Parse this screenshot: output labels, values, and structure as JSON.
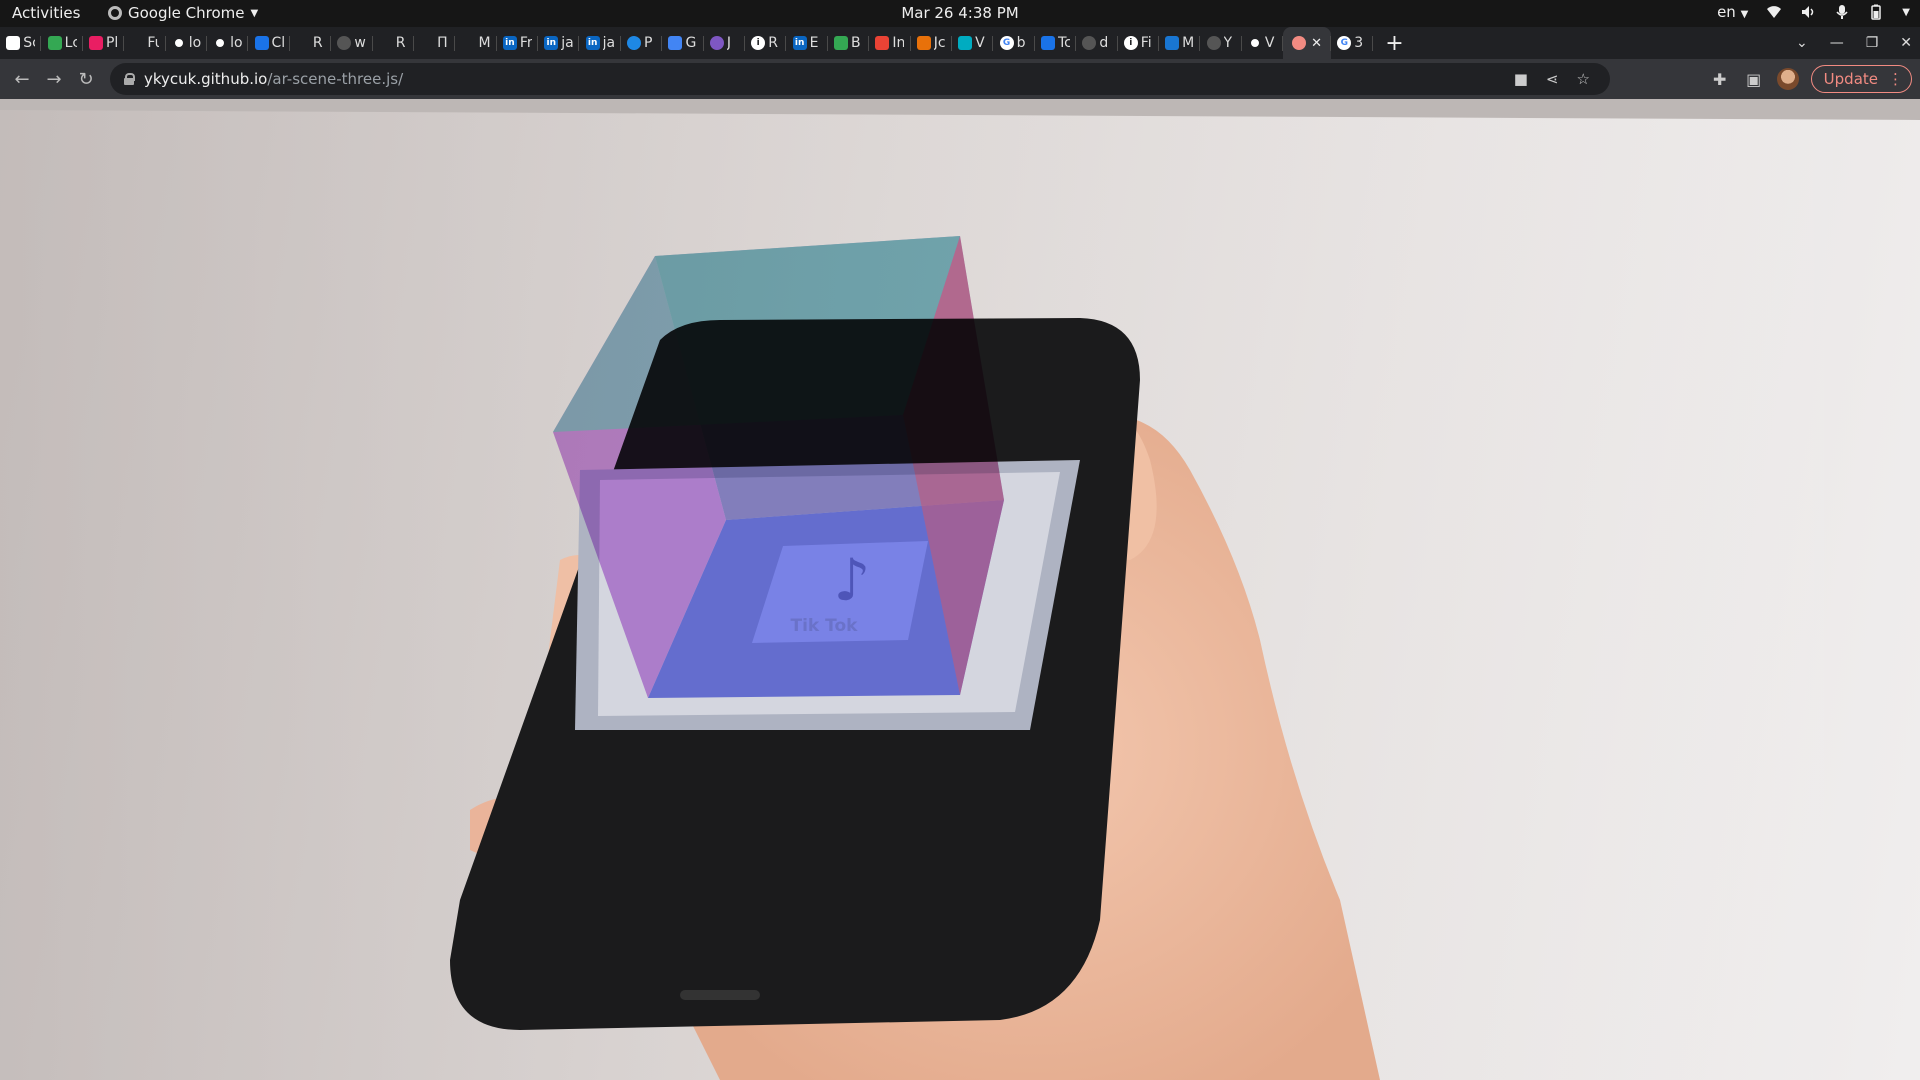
{
  "topbar": {
    "activities": "Activities",
    "app_name": "Google Chrome",
    "clock": "Mar 26  4:38 PM",
    "lang": "en"
  },
  "tabs": [
    {
      "text": "Sc",
      "icon": "generic",
      "color": "#ffffff"
    },
    {
      "text": "Lc",
      "icon": "leaf",
      "color": "#34a853"
    },
    {
      "text": "Pl",
      "icon": "app",
      "color": "#e91e63"
    },
    {
      "text": "Fu",
      "icon": "generic",
      "color": "#202124"
    },
    {
      "text": "lo",
      "icon": "github",
      "color": "#ffffff"
    },
    {
      "text": "lo",
      "icon": "github",
      "color": "#ffffff"
    },
    {
      "text": "Cl",
      "icon": "chart",
      "color": "#1a73e8"
    },
    {
      "text": "R",
      "icon": "generic",
      "color": "#202124"
    },
    {
      "text": "w",
      "icon": "github",
      "color": "#555555"
    },
    {
      "text": "R",
      "icon": "generic",
      "color": "#202124"
    },
    {
      "text": "П",
      "icon": "generic",
      "color": "#202124"
    },
    {
      "text": "M",
      "icon": "generic",
      "color": "#202124"
    },
    {
      "text": "Fr",
      "icon": "linkedin",
      "color": "#0a66c2"
    },
    {
      "text": "ja",
      "icon": "linkedin",
      "color": "#0a66c2"
    },
    {
      "text": "ja",
      "icon": "linkedin",
      "color": "#0a66c2"
    },
    {
      "text": "P",
      "icon": "circle",
      "color": "#1e88e5"
    },
    {
      "text": "G",
      "icon": "translate",
      "color": "#4285f4"
    },
    {
      "text": "J",
      "icon": "circle",
      "color": "#7e57c2"
    },
    {
      "text": "R",
      "icon": "info",
      "color": "#ffffff"
    },
    {
      "text": "E",
      "icon": "linkedin",
      "color": "#0a66c2"
    },
    {
      "text": "B",
      "icon": "maps",
      "color": "#34a853"
    },
    {
      "text": "In",
      "icon": "gmail",
      "color": "#ea4335"
    },
    {
      "text": "Jc",
      "icon": "app",
      "color": "#e8710a"
    },
    {
      "text": "V",
      "icon": "app",
      "color": "#00acc1"
    },
    {
      "text": "b",
      "icon": "google",
      "color": "#ffffff"
    },
    {
      "text": "Tc",
      "icon": "app",
      "color": "#1a73e8"
    },
    {
      "text": "d",
      "icon": "github",
      "color": "#555555"
    },
    {
      "text": "Fi",
      "icon": "info",
      "color": "#ffffff"
    },
    {
      "text": "M",
      "icon": "app",
      "color": "#1976d2"
    },
    {
      "text": "Y",
      "icon": "github",
      "color": "#555555"
    },
    {
      "text": "V",
      "icon": "github",
      "color": "#ffffff"
    },
    {
      "text": "",
      "icon": "record",
      "color": "#f28b82",
      "active": true
    },
    {
      "text": "3",
      "icon": "google",
      "color": "#ffffff"
    }
  ],
  "address": {
    "host": "ykycuk.github.io",
    "path": "/ar-scene-three.js/"
  },
  "update_label": "Update",
  "scene": {
    "marker_label": "Tik Tok",
    "cube_colors": {
      "top": "#6fd6c4",
      "left": "#b254d8",
      "right": "#e86a8c",
      "front": "#4a3fb4",
      "bottom": "#5a67e8"
    }
  }
}
